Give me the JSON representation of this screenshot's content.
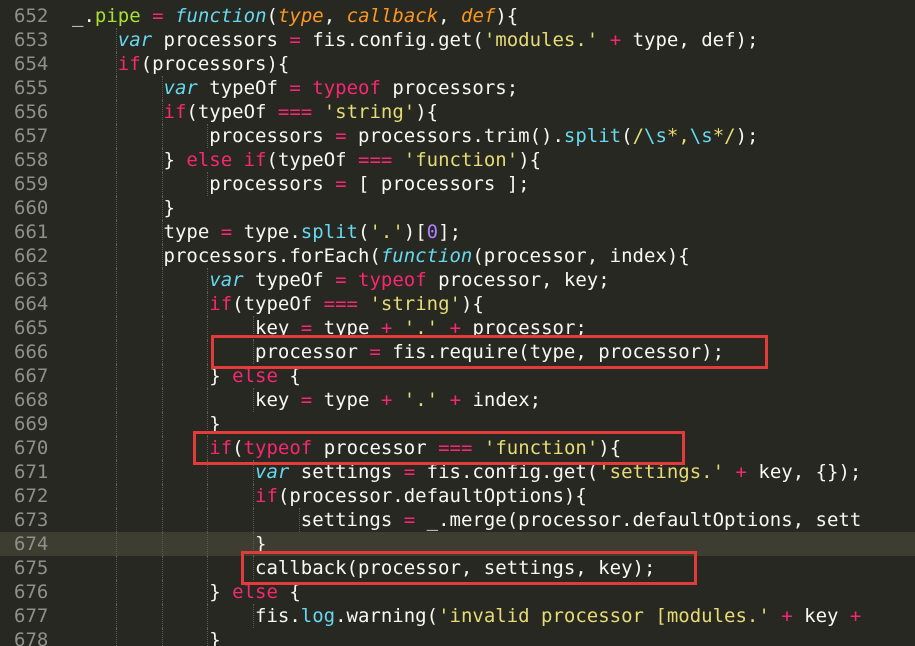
{
  "editor": {
    "theme": {
      "background": "#272822",
      "current_line": "#3e3d32",
      "highlight_box": "#e33a3a"
    },
    "current_line_number": "674",
    "lines": [
      {
        "num": "652",
        "indent": 0,
        "tokens": [
          [
            "_",
            "plain"
          ],
          [
            ".",
            "plain"
          ],
          [
            "pipe",
            "func"
          ],
          [
            " = ",
            "keyword"
          ],
          [
            "function",
            "storage"
          ],
          [
            "(",
            "plain"
          ],
          [
            "type",
            "param"
          ],
          [
            ", ",
            "plain"
          ],
          [
            "callback",
            "param"
          ],
          [
            ", ",
            "plain"
          ],
          [
            "def",
            "param"
          ],
          [
            "){",
            "plain"
          ]
        ]
      },
      {
        "num": "653",
        "indent": 1,
        "tokens": [
          [
            "var",
            "storage"
          ],
          [
            " processors ",
            "plain"
          ],
          [
            "=",
            "keyword"
          ],
          [
            " fis.config.get(",
            "plain"
          ],
          [
            "'modules.'",
            "string"
          ],
          [
            " ",
            "plain"
          ],
          [
            "+",
            "keyword"
          ],
          [
            " type, def);",
            "plain"
          ]
        ]
      },
      {
        "num": "654",
        "indent": 1,
        "tokens": [
          [
            "if",
            "keyword"
          ],
          [
            "(processors){",
            "plain"
          ]
        ]
      },
      {
        "num": "655",
        "indent": 2,
        "tokens": [
          [
            "var",
            "storage"
          ],
          [
            " typeOf ",
            "plain"
          ],
          [
            "=",
            "keyword"
          ],
          [
            " ",
            "plain"
          ],
          [
            "typeof",
            "keyword"
          ],
          [
            " processors;",
            "plain"
          ]
        ]
      },
      {
        "num": "656",
        "indent": 2,
        "tokens": [
          [
            "if",
            "keyword"
          ],
          [
            "(typeOf ",
            "plain"
          ],
          [
            "===",
            "keyword"
          ],
          [
            " ",
            "plain"
          ],
          [
            "'string'",
            "string"
          ],
          [
            "){",
            "plain"
          ]
        ]
      },
      {
        "num": "657",
        "indent": 3,
        "tokens": [
          [
            "processors ",
            "plain"
          ],
          [
            "=",
            "keyword"
          ],
          [
            " processors.trim().",
            "plain"
          ],
          [
            "split",
            "support"
          ],
          [
            "(",
            "plain"
          ],
          [
            "/",
            "string"
          ],
          [
            "\\s",
            "support"
          ],
          [
            "*,",
            "string"
          ],
          [
            "\\s",
            "support"
          ],
          [
            "*/",
            "string"
          ],
          [
            ");",
            "plain"
          ]
        ]
      },
      {
        "num": "658",
        "indent": 2,
        "tokens": [
          [
            "} ",
            "plain"
          ],
          [
            "else",
            "keyword"
          ],
          [
            " ",
            "plain"
          ],
          [
            "if",
            "keyword"
          ],
          [
            "(typeOf ",
            "plain"
          ],
          [
            "===",
            "keyword"
          ],
          [
            " ",
            "plain"
          ],
          [
            "'function'",
            "string"
          ],
          [
            "){",
            "plain"
          ]
        ]
      },
      {
        "num": "659",
        "indent": 3,
        "tokens": [
          [
            "processors ",
            "plain"
          ],
          [
            "=",
            "keyword"
          ],
          [
            " [ processors ];",
            "plain"
          ]
        ]
      },
      {
        "num": "660",
        "indent": 2,
        "tokens": [
          [
            "}",
            "plain"
          ]
        ]
      },
      {
        "num": "661",
        "indent": 2,
        "tokens": [
          [
            "type ",
            "plain"
          ],
          [
            "=",
            "keyword"
          ],
          [
            " type.",
            "plain"
          ],
          [
            "split",
            "support"
          ],
          [
            "(",
            "plain"
          ],
          [
            "'.'",
            "string"
          ],
          [
            ")[",
            "plain"
          ],
          [
            "0",
            "number"
          ],
          [
            "];",
            "plain"
          ]
        ]
      },
      {
        "num": "662",
        "indent": 2,
        "tokens": [
          [
            "processors.forEach(",
            "plain"
          ],
          [
            "function",
            "storage"
          ],
          [
            "(processor, index){",
            "plain"
          ]
        ]
      },
      {
        "num": "663",
        "indent": 3,
        "tokens": [
          [
            "var",
            "storage"
          ],
          [
            " typeOf ",
            "plain"
          ],
          [
            "=",
            "keyword"
          ],
          [
            " ",
            "plain"
          ],
          [
            "typeof",
            "keyword"
          ],
          [
            " processor, key;",
            "plain"
          ]
        ]
      },
      {
        "num": "664",
        "indent": 3,
        "tokens": [
          [
            "if",
            "keyword"
          ],
          [
            "(typeOf ",
            "plain"
          ],
          [
            "===",
            "keyword"
          ],
          [
            " ",
            "plain"
          ],
          [
            "'string'",
            "string"
          ],
          [
            "){",
            "plain"
          ]
        ]
      },
      {
        "num": "665",
        "indent": 4,
        "tokens": [
          [
            "key ",
            "plain"
          ],
          [
            "=",
            "keyword"
          ],
          [
            " type ",
            "plain"
          ],
          [
            "+",
            "keyword"
          ],
          [
            " ",
            "plain"
          ],
          [
            "'.'",
            "string"
          ],
          [
            " ",
            "plain"
          ],
          [
            "+",
            "keyword"
          ],
          [
            " processor;",
            "plain"
          ]
        ]
      },
      {
        "num": "666",
        "indent": 4,
        "tokens": [
          [
            "processor ",
            "plain"
          ],
          [
            "=",
            "keyword"
          ],
          [
            " fis.require(type, processor);",
            "plain"
          ]
        ]
      },
      {
        "num": "667",
        "indent": 3,
        "tokens": [
          [
            "} ",
            "plain"
          ],
          [
            "else",
            "keyword"
          ],
          [
            " {",
            "plain"
          ]
        ]
      },
      {
        "num": "668",
        "indent": 4,
        "tokens": [
          [
            "key ",
            "plain"
          ],
          [
            "=",
            "keyword"
          ],
          [
            " type ",
            "plain"
          ],
          [
            "+",
            "keyword"
          ],
          [
            " ",
            "plain"
          ],
          [
            "'.'",
            "string"
          ],
          [
            " ",
            "plain"
          ],
          [
            "+",
            "keyword"
          ],
          [
            " index;",
            "plain"
          ]
        ]
      },
      {
        "num": "669",
        "indent": 3,
        "tokens": [
          [
            "}",
            "plain"
          ]
        ]
      },
      {
        "num": "670",
        "indent": 3,
        "tokens": [
          [
            "if",
            "keyword"
          ],
          [
            "(",
            "plain"
          ],
          [
            "typeof",
            "keyword"
          ],
          [
            " processor ",
            "plain"
          ],
          [
            "===",
            "keyword"
          ],
          [
            " ",
            "plain"
          ],
          [
            "'function'",
            "string"
          ],
          [
            "){",
            "plain"
          ]
        ]
      },
      {
        "num": "671",
        "indent": 4,
        "tokens": [
          [
            "var",
            "storage"
          ],
          [
            " settings ",
            "plain"
          ],
          [
            "=",
            "keyword"
          ],
          [
            " fis.config.get(",
            "plain"
          ],
          [
            "'settings.'",
            "string"
          ],
          [
            " ",
            "plain"
          ],
          [
            "+",
            "keyword"
          ],
          [
            " key, {});",
            "plain"
          ]
        ]
      },
      {
        "num": "672",
        "indent": 4,
        "tokens": [
          [
            "if",
            "keyword"
          ],
          [
            "(processor.defaultOptions){",
            "plain"
          ]
        ]
      },
      {
        "num": "673",
        "indent": 5,
        "tokens": [
          [
            "settings ",
            "plain"
          ],
          [
            "=",
            "keyword"
          ],
          [
            " _.merge(processor.defaultOptions, sett",
            "plain"
          ]
        ]
      },
      {
        "num": "674",
        "indent": 4,
        "tokens": [
          [
            "}",
            "plain"
          ]
        ]
      },
      {
        "num": "675",
        "indent": 4,
        "tokens": [
          [
            "callback(processor, settings, key);",
            "plain"
          ]
        ]
      },
      {
        "num": "676",
        "indent": 3,
        "tokens": [
          [
            "} ",
            "plain"
          ],
          [
            "else",
            "keyword"
          ],
          [
            " {",
            "plain"
          ]
        ]
      },
      {
        "num": "677",
        "indent": 4,
        "tokens": [
          [
            "fis.",
            "plain"
          ],
          [
            "log",
            "support"
          ],
          [
            ".warning(",
            "plain"
          ],
          [
            "'invalid processor [modules.'",
            "string"
          ],
          [
            " ",
            "plain"
          ],
          [
            "+",
            "keyword"
          ],
          [
            " key ",
            "plain"
          ],
          [
            "+",
            "keyword"
          ]
        ]
      },
      {
        "num": "678",
        "indent": 3,
        "tokens": [
          [
            "}",
            "plain"
          ]
        ]
      }
    ],
    "highlights": [
      "666",
      "670",
      "675"
    ]
  }
}
